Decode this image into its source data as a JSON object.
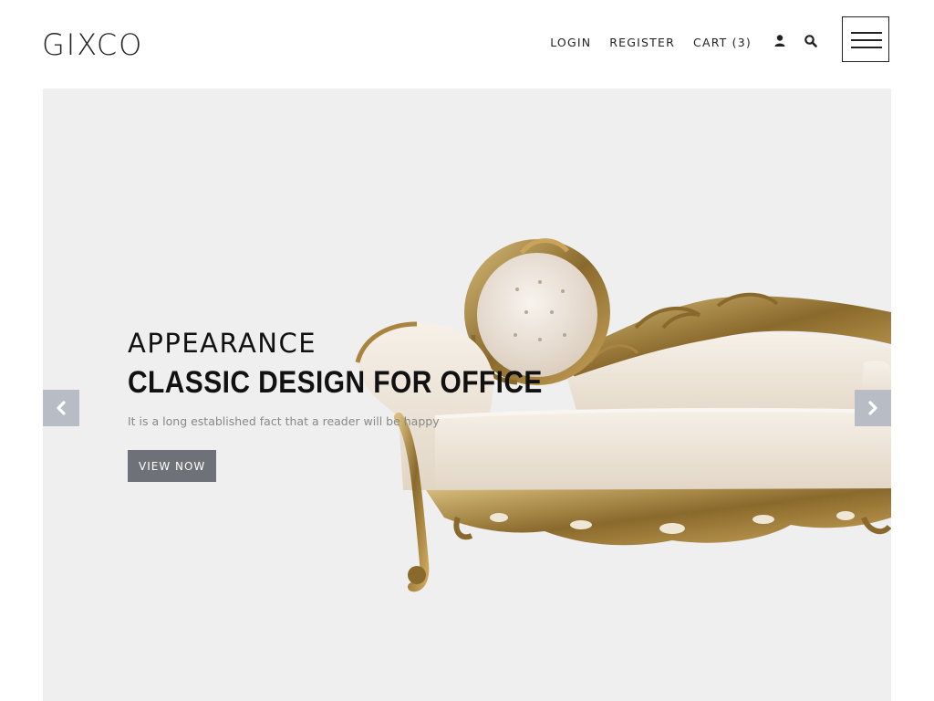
{
  "header": {
    "logo_text": "GIXCO",
    "nav": {
      "login": "LOGIN",
      "register": "REGISTER",
      "cart": "CART (3)"
    },
    "icons": {
      "account": "user-icon",
      "search": "search-icon",
      "menu": "hamburger-menu-icon"
    }
  },
  "hero": {
    "kicker": "APPEARANCE",
    "title": "CLASSIC DESIGN FOR OFFICE",
    "description": "It is a long established fact that a reader will be happy",
    "cta_label": "VIEW NOW",
    "image": "ornate-gold-chaise-longue-sofa",
    "prev_icon": "chevron-left-icon",
    "next_icon": "chevron-right-icon"
  },
  "colors": {
    "hero_background": "#efefef",
    "button_background": "#6e7177",
    "arrow_background": "#b8bcc4",
    "text": "#111111",
    "muted_text": "#888888",
    "sofa_gold": "#a8843f",
    "sofa_cream": "#ece3d6"
  }
}
